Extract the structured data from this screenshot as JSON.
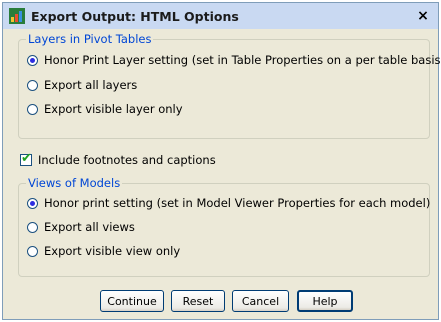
{
  "window": {
    "title": "Export Output: HTML Options",
    "close_label": "×"
  },
  "layers_group": {
    "legend": "Layers in Pivot Tables",
    "options": [
      {
        "label": "Honor Print Layer setting (set in Table Properties on a per table basis)",
        "selected": true,
        "mnemonic": "H"
      },
      {
        "label": "Export all layers",
        "selected": false,
        "mnemonic": "x"
      },
      {
        "label": "Export visible layer only",
        "selected": false,
        "mnemonic": "v"
      }
    ]
  },
  "footnotes_checkbox": {
    "label": "Include footnotes and captions",
    "checked": true,
    "mnemonic": "f"
  },
  "models_group": {
    "legend": "Views of Models",
    "options": [
      {
        "label": "Honor print setting (set in Model Viewer Properties for each model)",
        "selected": true
      },
      {
        "label": "Export all views",
        "selected": false
      },
      {
        "label": "Export visible view only",
        "selected": false
      }
    ]
  },
  "buttons": {
    "continue": "Continue",
    "reset": "Reset",
    "cancel": "Cancel",
    "help": "Help"
  },
  "colors": {
    "legend_text": "#0046d5",
    "dialog_bg": "#ece9d8",
    "titlebar_bg": "#c9d9f2",
    "radio_dot": "#2d2de0",
    "check_mark": "#21a121"
  }
}
